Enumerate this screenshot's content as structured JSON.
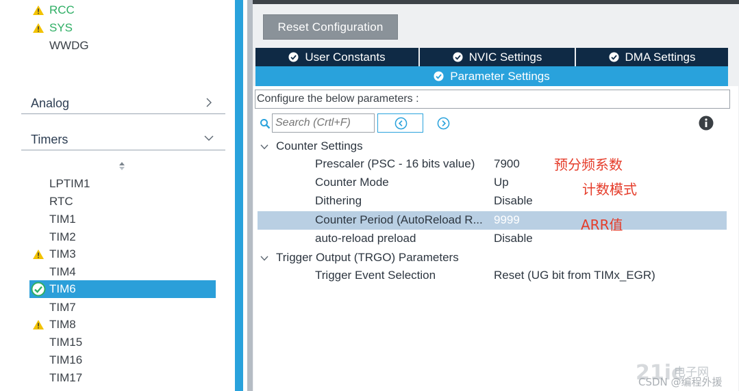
{
  "sidebar": {
    "top_items": [
      {
        "label": "RCC",
        "status": "warning",
        "color": "#2eae64"
      },
      {
        "label": "SYS",
        "status": "warning",
        "color": "#2eae64"
      },
      {
        "label": "WWDG",
        "status": "none"
      }
    ],
    "categories": [
      {
        "label": "Analog",
        "icon": "chevron-right-icon"
      },
      {
        "label": "Timers",
        "icon": "chevron-down-icon"
      }
    ],
    "timers": [
      {
        "label": "LPTIM1",
        "status": "none"
      },
      {
        "label": "RTC",
        "status": "none"
      },
      {
        "label": "TIM1",
        "status": "none"
      },
      {
        "label": "TIM2",
        "status": "none"
      },
      {
        "label": "TIM3",
        "status": "warning"
      },
      {
        "label": "TIM4",
        "status": "none"
      },
      {
        "label": "TIM6",
        "status": "enabled",
        "selected": true
      },
      {
        "label": "TIM7",
        "status": "none"
      },
      {
        "label": "TIM8",
        "status": "warning"
      },
      {
        "label": "TIM15",
        "status": "none"
      },
      {
        "label": "TIM16",
        "status": "none"
      },
      {
        "label": "TIM17",
        "status": "none"
      }
    ]
  },
  "toolbar": {
    "reset_label": "Reset Configuration"
  },
  "tabs": {
    "user_constants": "User Constants",
    "nvic_settings": "NVIC Settings",
    "dma_settings": "DMA Settings",
    "parameter_settings": "Parameter Settings"
  },
  "params": {
    "configure_label": "Configure the below parameters :",
    "search_placeholder": "Search (Crtl+F)",
    "groups": [
      {
        "label": "Counter Settings",
        "rows": [
          {
            "name": "Prescaler (PSC - 16 bits value)",
            "value": "7900"
          },
          {
            "name": "Counter Mode",
            "value": "Up"
          },
          {
            "name": "Dithering",
            "value": "Disable"
          },
          {
            "name": "Counter Period (AutoReload R...",
            "value": "9999",
            "selected": true
          },
          {
            "name": "auto-reload preload",
            "value": "Disable"
          }
        ]
      },
      {
        "label": "Trigger Output (TRGO) Parameters",
        "rows": [
          {
            "name": "Trigger Event Selection",
            "value": "Reset (UG bit from TIMx_EGR)"
          }
        ]
      }
    ]
  },
  "annotations": {
    "prescaler": "预分频系数",
    "counter_mode": "计数模式",
    "arr": "ARR值"
  },
  "watermark": {
    "logo": "21ic",
    "site": "电子网",
    "credit": "CSDN @编程外援"
  },
  "colors": {
    "accent": "#29a2dc",
    "tab_dark": "#0f2a45",
    "warning": "#f2c200",
    "annotation": "#e53c2a",
    "status_green": "#2eae64"
  }
}
